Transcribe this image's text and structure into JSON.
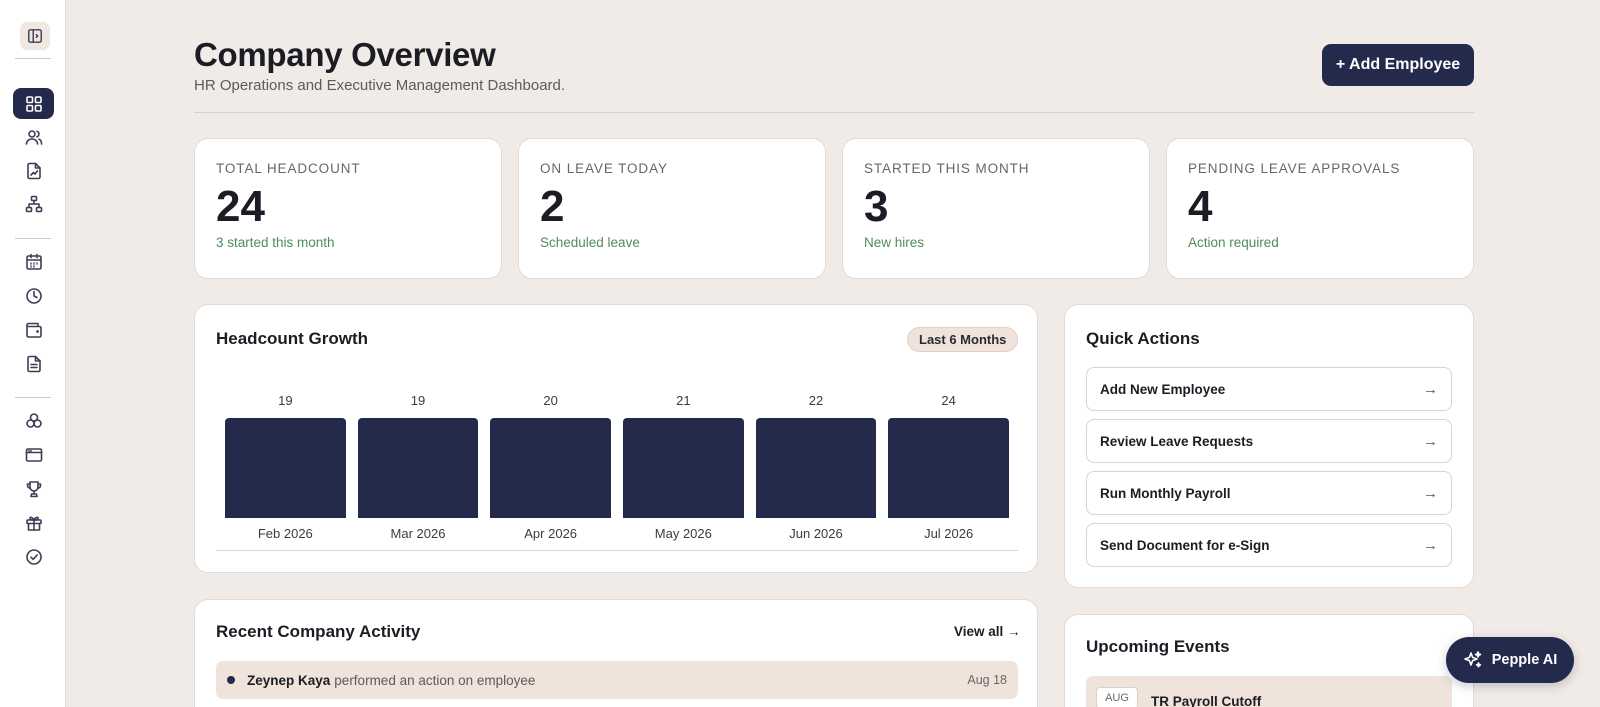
{
  "sidebar": {
    "toggle_icon": "sidebar-toggle-icon",
    "items": [
      {
        "icon": "dashboard-grid-icon",
        "active": true
      },
      {
        "icon": "users-icon",
        "active": false
      },
      {
        "icon": "file-signature-icon",
        "active": false
      },
      {
        "icon": "org-chart-icon",
        "active": false
      },
      {
        "icon": "calendar-icon",
        "active": false
      },
      {
        "icon": "clock-icon",
        "active": false
      },
      {
        "icon": "wallet-icon",
        "active": false
      },
      {
        "icon": "document-icon",
        "active": false
      },
      {
        "icon": "circles-icon",
        "active": false
      },
      {
        "icon": "browser-window-icon",
        "active": false
      },
      {
        "icon": "trophy-icon",
        "active": false
      },
      {
        "icon": "gift-icon",
        "active": false
      },
      {
        "icon": "check-circle-icon",
        "active": false
      }
    ]
  },
  "header": {
    "title": "Company Overview",
    "subtitle": "HR Operations and Executive Management Dashboard.",
    "add_button": "+ Add Employee"
  },
  "stats": [
    {
      "label": "Total Headcount",
      "value": "24",
      "note": "3 started this month"
    },
    {
      "label": "On Leave Today",
      "value": "2",
      "note": "Scheduled leave"
    },
    {
      "label": "Started This Month",
      "value": "3",
      "note": "New hires"
    },
    {
      "label": "Pending Leave Approvals",
      "value": "4",
      "note": "Action required"
    }
  ],
  "headcount": {
    "title": "Headcount Growth",
    "range_label": "Last 6 Months"
  },
  "chart_data": {
    "type": "bar",
    "categories": [
      "Feb 2026",
      "Mar 2026",
      "Apr 2026",
      "May 2026",
      "Jun 2026",
      "Jul 2026"
    ],
    "values": [
      19,
      19,
      20,
      21,
      22,
      24
    ],
    "title": "Headcount Growth",
    "xlabel": "",
    "ylabel": "",
    "grid": false
  },
  "quick_actions": {
    "title": "Quick Actions",
    "arrow": "→",
    "items": [
      "Add New Employee",
      "Review Leave Requests",
      "Run Monthly Payroll",
      "Send Document for e-Sign"
    ]
  },
  "activity": {
    "title": "Recent Company Activity",
    "view_all": "View all →",
    "rows": [
      {
        "name": "Zeynep Kaya",
        "text": "performed an action on employee",
        "date": "Aug 18"
      }
    ]
  },
  "events": {
    "title": "Upcoming Events",
    "rows": [
      {
        "month": "AUG",
        "title": "TR Payroll Cutoff"
      }
    ]
  },
  "ai_button": {
    "label": "Pepple AI",
    "icon": "sparkles-icon"
  },
  "colors": {
    "accent": "#242a4b",
    "background": "#f1ebe7",
    "positive": "#4f8a62",
    "highlight": "#efe3dc"
  }
}
